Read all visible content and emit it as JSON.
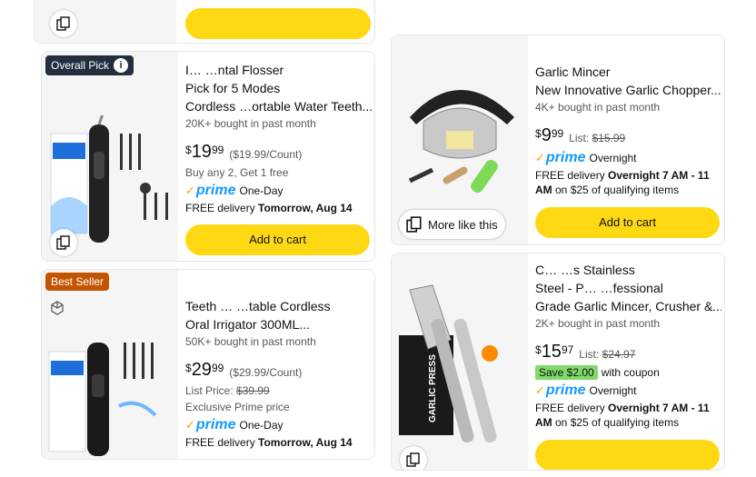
{
  "colors": {
    "cart_button": "#ffd814",
    "overall_pick_badge": "#232f3e",
    "best_seller_badge": "#c45500",
    "prime_blue": "#1399ff",
    "prime_check": "#ff9900",
    "coupon_green": "#7fda69"
  },
  "products": [
    {
      "badge": "Overall Pick",
      "badge_icon": "info-icon",
      "title_line1": "I…                  …ntal Flosser",
      "title_line2": "Pick for                  5 Modes",
      "title_line3": "Cordless            …ortable Water Teeth...",
      "bought": "20K+ bought in past month",
      "price_currency": "$",
      "price_whole": "19",
      "price_fraction": "99",
      "unit_price": "($19.99/Count)",
      "extra_line": "Buy any 2, Get 1 free",
      "prime_label": "prime",
      "prime_speed": "One-Day",
      "delivery_prefix": "FREE delivery ",
      "delivery_date": "Tomorrow, Aug 14",
      "button": "Add to cart"
    },
    {
      "badge": "Best Seller",
      "title_line1": "",
      "title_line2": "Teeth          …  …table Cordless",
      "title_line3": "Oral Irrigator 300ML...",
      "bought": "50K+ bought in past month",
      "price_currency": "$",
      "price_whole": "29",
      "price_fraction": "99",
      "unit_price": "($29.99/Count)",
      "list_label": "List Price: ",
      "list_price": "$39.99",
      "extra_line": "Exclusive Prime price",
      "prime_label": "prime",
      "prime_speed": "One-Day",
      "delivery_prefix": "FREE delivery ",
      "delivery_date": "Tomorrow, Aug 14"
    },
    {
      "title_line1": "",
      "title_line2": "Garlic Mincer",
      "title_line3": "New Innovative Garlic Chopper...",
      "bought": "4K+ bought in past month",
      "price_currency": "$",
      "price_whole": "9",
      "price_fraction": "99",
      "list_label": "List: ",
      "list_price": "$15.99",
      "prime_label": "prime",
      "prime_speed": "Overnight",
      "delivery_prefix": "FREE delivery ",
      "delivery_date": "Overnight 7 AM - 11 AM",
      "delivery_suffix": " on $25 of qualifying items",
      "more_like_this": "More like this",
      "button": "Add to cart"
    },
    {
      "title_line1": "C…                  …s Stainless",
      "title_line2": "Steel - P…          …fessional",
      "title_line3": "Grade Garlic Mincer, Crusher &...",
      "bought": "2K+ bought in past month",
      "price_currency": "$",
      "price_whole": "15",
      "price_fraction": "97",
      "list_label": "List: ",
      "list_price": "$24.97",
      "coupon_badge": "Save $2.00",
      "coupon_text": "with coupon",
      "prime_label": "prime",
      "prime_speed": "Overnight",
      "delivery_prefix": "FREE delivery ",
      "delivery_date": "Overnight 7 AM - 11 AM",
      "delivery_suffix": " on $25 of qualifying items",
      "package_text": "GARLIC PRESS"
    }
  ]
}
